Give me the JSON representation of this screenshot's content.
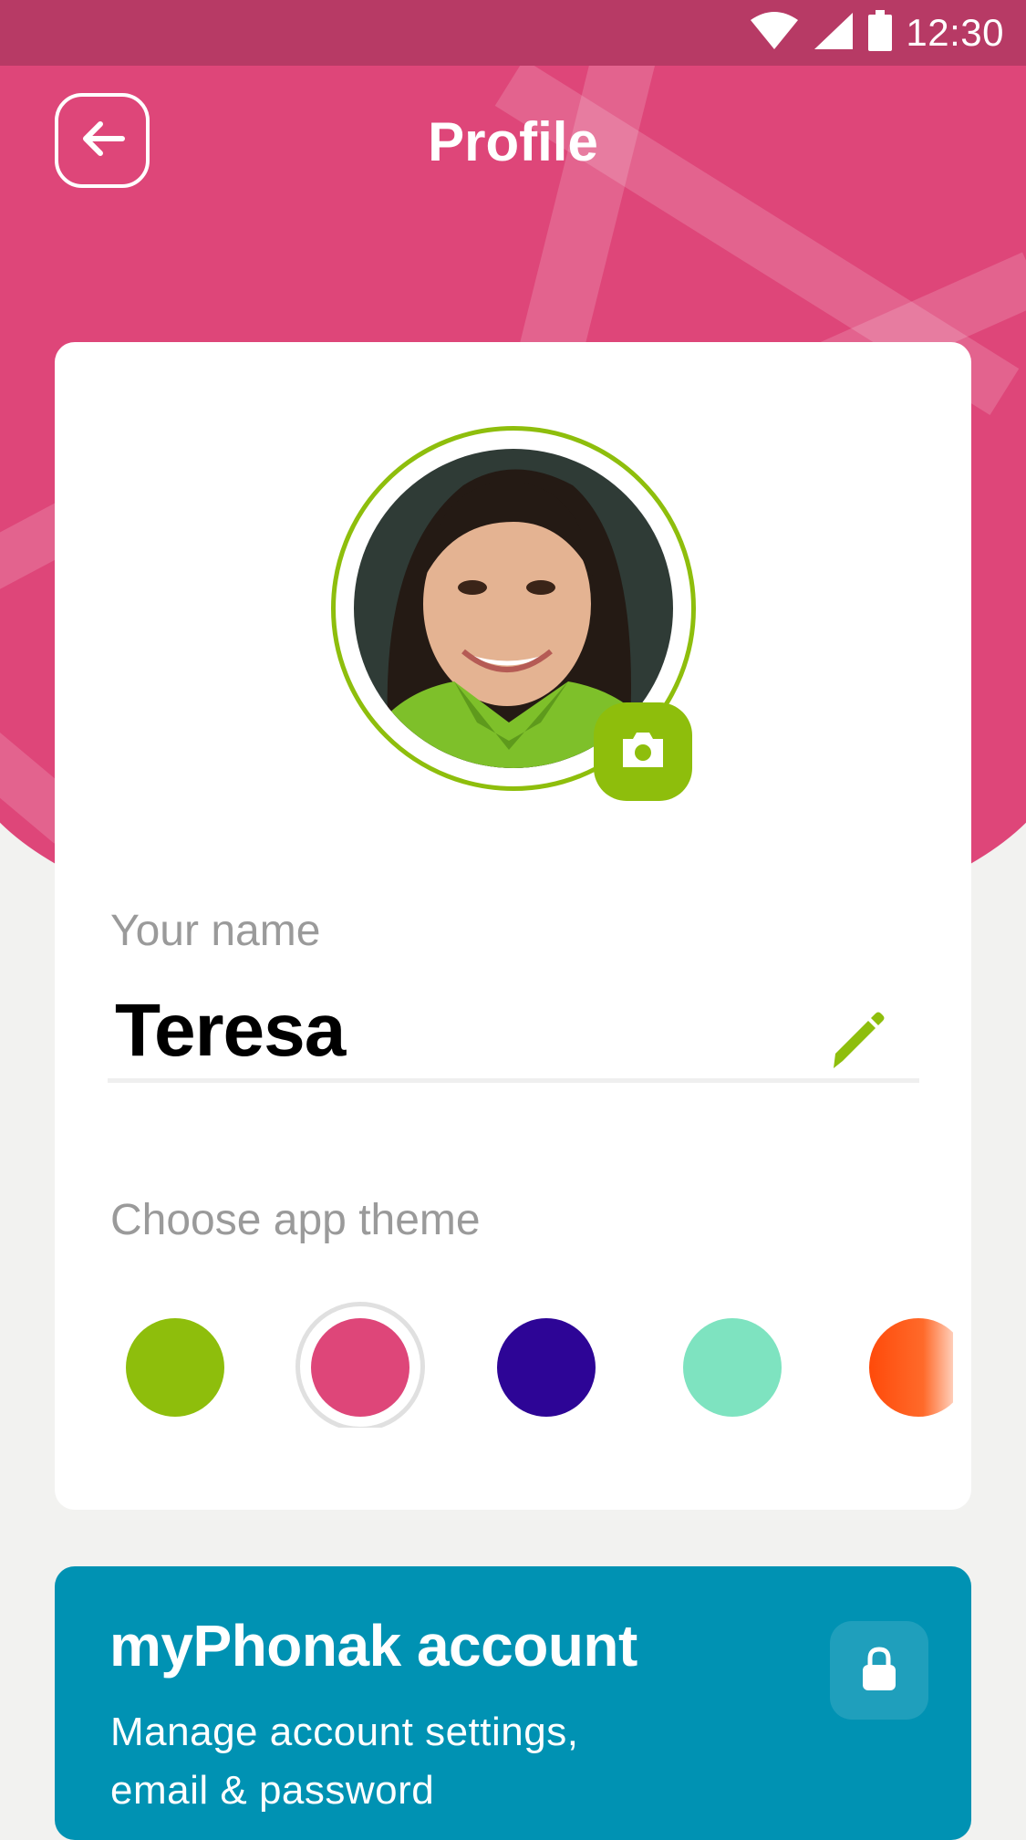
{
  "status_bar": {
    "time": "12:30"
  },
  "header": {
    "title": "Profile"
  },
  "profile": {
    "name_label": "Your name",
    "name_value": "Teresa",
    "theme_label": "Choose app theme",
    "themes": [
      {
        "color": "#8ebe0c",
        "selected": false
      },
      {
        "color": "#de4679",
        "selected": true
      },
      {
        "color": "#2d0596",
        "selected": false
      },
      {
        "color": "#7ee3c0",
        "selected": false
      },
      {
        "color": "#ff4a0a",
        "selected": false
      }
    ]
  },
  "account": {
    "title": "myPhonak account",
    "description": "Manage account settings, email & password"
  },
  "colors": {
    "header_pink": "#de4679",
    "status_bar": "#b73a65",
    "accent_green": "#8ebe0c",
    "account_blue": "#0092b3"
  }
}
